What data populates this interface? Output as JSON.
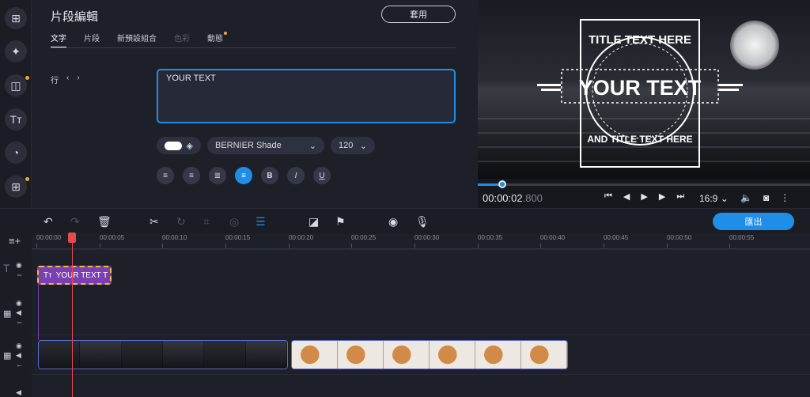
{
  "editor": {
    "title": "片段編輯",
    "apply_label": "套用",
    "tabs": [
      {
        "label": "文字"
      },
      {
        "label": "片段"
      },
      {
        "label": "新預設組合"
      },
      {
        "label": "色彩"
      },
      {
        "label": "動態"
      }
    ],
    "row_label": "行",
    "text_value": "YOUR TEXT",
    "font_name": "BERNIER Shade",
    "font_size": "120"
  },
  "preview": {
    "overlay_top": "TITLE TEXT HERE",
    "overlay_main": "YOUR TEXT",
    "overlay_bottom": "AND TITLE TEXT HERE",
    "time_main": "00:00:02",
    "time_ms": ".800",
    "aspect": "16:9",
    "progress_fraction": 0.074
  },
  "timeline": {
    "export_label": "匯出",
    "ticks": [
      "00:00:00",
      "00:00:05",
      "00:00:10",
      "00:00:15",
      "00:00:20",
      "00:00:25",
      "00:00:30",
      "00:00:35",
      "00:00:40",
      "00:00:45",
      "00:00:50",
      "00:00:55"
    ],
    "title_clip_label": "YOUR TEXT T"
  },
  "colors": {
    "accent": "#1f8ee8",
    "clip_title": "#7a3fb0",
    "playhead": "#e84a4a",
    "badge": "#f0a830"
  }
}
